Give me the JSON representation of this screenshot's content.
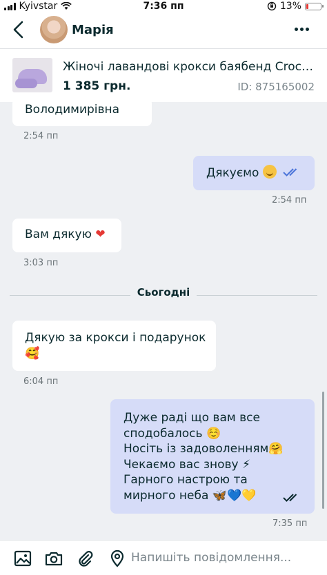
{
  "status_bar": {
    "carrier": "Kyivstar",
    "time": "7:36 пп",
    "battery": "13%",
    "battery_level": 0.13
  },
  "header": {
    "name": "Марія"
  },
  "product": {
    "title": "Жіночі лавандові крокси баябенд Crocs B...",
    "price": "1 385 грн.",
    "id": "ID: 875165002"
  },
  "messages": [
    {
      "dir": "in",
      "text": "Володимирівна",
      "time": "2:54 пп"
    },
    {
      "dir": "out",
      "text": "Дякуємо",
      "emoji": "smile-emoji",
      "time": "2:54 пп",
      "read": true
    },
    {
      "dir": "in",
      "text": "Вам дякую",
      "emoji": "❤",
      "time": "3:03 пп"
    },
    {
      "dir": "in",
      "lines": [
        "Дякую за крокси і подарунок",
        "🥰"
      ],
      "time": "6:04 пп"
    },
    {
      "dir": "out",
      "lines": [
        "Дуже раді що вам все",
        "сподобалось ☺️",
        "Носіть із задоволенням🤗",
        "Чекаємо вас знову ⚡",
        "Гарного настрою та",
        "мирного неба 🦋💙💛"
      ],
      "time": "7:35 пп",
      "read": true
    }
  ],
  "day_separator": "Сьогодні",
  "composer": {
    "placeholder": "Напишіть повідомлення..."
  },
  "colors": {
    "incoming": "#ffffff",
    "outgoing": "#d6dcf8",
    "read_check": "#4a73d9",
    "background": "#eef0f3",
    "text": "#0b2a2e"
  }
}
